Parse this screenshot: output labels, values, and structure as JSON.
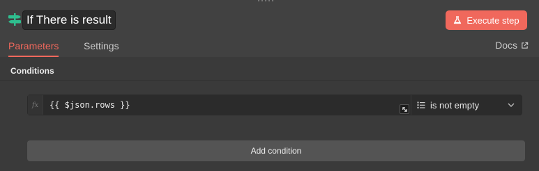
{
  "header": {
    "node_title": "If There is result",
    "execute_label": "Execute step",
    "accent_color": "#f0685c",
    "node_icon_color": "#2fbf8f"
  },
  "tabs": [
    {
      "label": "Parameters",
      "active": true
    },
    {
      "label": "Settings",
      "active": false
    }
  ],
  "docs_label": "Docs",
  "conditions": {
    "section_label": "Conditions",
    "rows": [
      {
        "fx_label": "fx",
        "expression": "{{ $json.rows }}",
        "operator": "is not empty"
      }
    ],
    "add_label": "Add condition"
  },
  "icons": {
    "node": "signpost-icon",
    "execute": "flask-icon",
    "docs": "external-link-icon",
    "expand": "expand-icon",
    "operator": "list-icon",
    "dropdown": "chevron-down-icon"
  }
}
